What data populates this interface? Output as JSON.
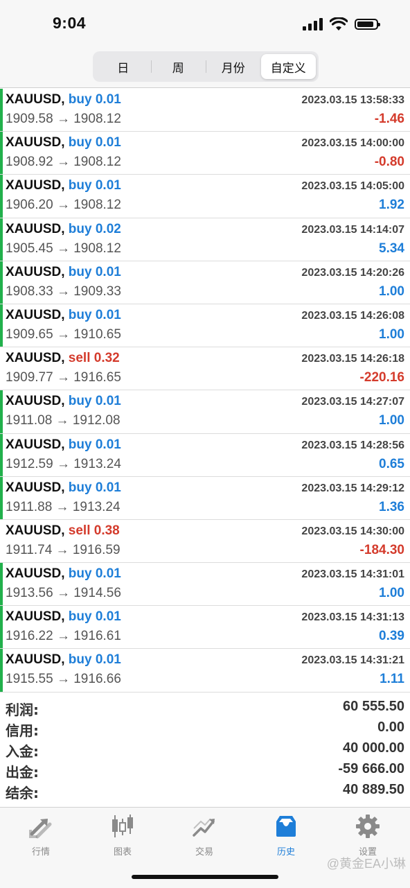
{
  "status_bar": {
    "time": "9:04"
  },
  "period_tabs": [
    {
      "label": "日",
      "active": false
    },
    {
      "label": "周",
      "active": false
    },
    {
      "label": "月份",
      "active": false
    },
    {
      "label": "自定义",
      "active": true
    }
  ],
  "trades": [
    {
      "symbol": "XAUUSD,",
      "type": "buy",
      "lots": "0.01",
      "type_label": "buy 0.01",
      "datetime": "2023.03.15 13:58:33",
      "prices": "1909.58 → 1908.12",
      "profit": "-1.46"
    },
    {
      "symbol": "XAUUSD,",
      "type": "buy",
      "lots": "0.01",
      "type_label": "buy 0.01",
      "datetime": "2023.03.15 14:00:00",
      "prices": "1908.92 → 1908.12",
      "profit": "-0.80"
    },
    {
      "symbol": "XAUUSD,",
      "type": "buy",
      "lots": "0.01",
      "type_label": "buy 0.01",
      "datetime": "2023.03.15 14:05:00",
      "prices": "1906.20 → 1908.12",
      "profit": "1.92"
    },
    {
      "symbol": "XAUUSD,",
      "type": "buy",
      "lots": "0.02",
      "type_label": "buy 0.02",
      "datetime": "2023.03.15 14:14:07",
      "prices": "1905.45 → 1908.12",
      "profit": "5.34"
    },
    {
      "symbol": "XAUUSD,",
      "type": "buy",
      "lots": "0.01",
      "type_label": "buy 0.01",
      "datetime": "2023.03.15 14:20:26",
      "prices": "1908.33 → 1909.33",
      "profit": "1.00"
    },
    {
      "symbol": "XAUUSD,",
      "type": "buy",
      "lots": "0.01",
      "type_label": "buy 0.01",
      "datetime": "2023.03.15 14:26:08",
      "prices": "1909.65 → 1910.65",
      "profit": "1.00"
    },
    {
      "symbol": "XAUUSD,",
      "type": "sell",
      "lots": "0.32",
      "type_label": "sell 0.32",
      "datetime": "2023.03.15 14:26:18",
      "prices": "1909.77 → 1916.65",
      "profit": "-220.16"
    },
    {
      "symbol": "XAUUSD,",
      "type": "buy",
      "lots": "0.01",
      "type_label": "buy 0.01",
      "datetime": "2023.03.15 14:27:07",
      "prices": "1911.08 → 1912.08",
      "profit": "1.00"
    },
    {
      "symbol": "XAUUSD,",
      "type": "buy",
      "lots": "0.01",
      "type_label": "buy 0.01",
      "datetime": "2023.03.15 14:28:56",
      "prices": "1912.59 → 1913.24",
      "profit": "0.65"
    },
    {
      "symbol": "XAUUSD,",
      "type": "buy",
      "lots": "0.01",
      "type_label": "buy 0.01",
      "datetime": "2023.03.15 14:29:12",
      "prices": "1911.88 → 1913.24",
      "profit": "1.36"
    },
    {
      "symbol": "XAUUSD,",
      "type": "sell",
      "lots": "0.38",
      "type_label": "sell 0.38",
      "datetime": "2023.03.15 14:30:00",
      "prices": "1911.74 → 1916.59",
      "profit": "-184.30"
    },
    {
      "symbol": "XAUUSD,",
      "type": "buy",
      "lots": "0.01",
      "type_label": "buy 0.01",
      "datetime": "2023.03.15 14:31:01",
      "prices": "1913.56 → 1914.56",
      "profit": "1.00"
    },
    {
      "symbol": "XAUUSD,",
      "type": "buy",
      "lots": "0.01",
      "type_label": "buy 0.01",
      "datetime": "2023.03.15 14:31:13",
      "prices": "1916.22 → 1916.61",
      "profit": "0.39"
    },
    {
      "symbol": "XAUUSD,",
      "type": "buy",
      "lots": "0.01",
      "type_label": "buy 0.01",
      "datetime": "2023.03.15 14:31:21",
      "prices": "1915.55 → 1916.66",
      "profit": "1.11"
    }
  ],
  "summary": [
    {
      "label": "利润:",
      "value": "60 555.50"
    },
    {
      "label": "信用:",
      "value": "0.00"
    },
    {
      "label": "入金:",
      "value": "40 000.00"
    },
    {
      "label": "出金:",
      "value": "-59 666.00"
    },
    {
      "label": "结余:",
      "value": "40 889.50"
    }
  ],
  "tab_bar": [
    {
      "label": "行情",
      "icon": "quotes-arrows-icon",
      "active": false
    },
    {
      "label": "图表",
      "icon": "candlestick-chart-icon",
      "active": false
    },
    {
      "label": "交易",
      "icon": "trade-trend-icon",
      "active": false
    },
    {
      "label": "历史",
      "icon": "history-inbox-icon",
      "active": true
    },
    {
      "label": "设置",
      "icon": "settings-gear-icon",
      "active": false
    }
  ],
  "watermark": "@黄金EA小琳",
  "colors": {
    "buy": "#1e7ed8",
    "sell": "#d43b2c",
    "accent": "#1e7ed8",
    "buy_bar": "#22b04c"
  }
}
